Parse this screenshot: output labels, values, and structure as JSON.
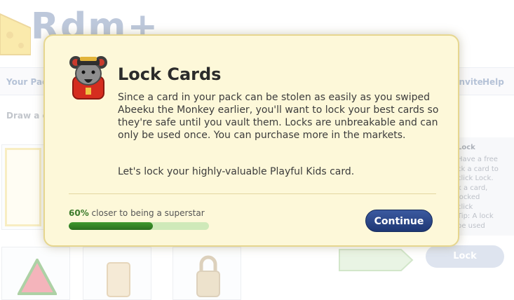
{
  "background": {
    "logo_text": "Rdm+",
    "nav": {
      "left_label": "Your Pack",
      "invite_label": "Invite",
      "help_label": "Help"
    },
    "subnav_label": "Draw a card",
    "side_panel": {
      "title": "Lock",
      "lines": [
        "Have a free",
        "ck a card to",
        "click Lock.",
        "k a card,",
        "locked",
        "click",
        "Tip: A lock",
        "be used"
      ]
    },
    "lock_button_label": "Lock"
  },
  "modal": {
    "title": "Lock Cards",
    "body": "Since a card in your pack can be stolen as easily as you swiped Abeeku the Monkey earlier, you'll want to lock your best cards so they're safe until you vault them. Locks are unbreakable and can only be used once. You can purchase more in the markets.",
    "prompt": "Let's lock your highly-valuable Playful Kids card.",
    "progress": {
      "percent_label": "60%",
      "label_rest": " closer to being a superstar",
      "value": 0.6
    },
    "continue_label": "Continue"
  },
  "colors": {
    "modal_bg": "#fdf8d9",
    "button": "#2b4687",
    "progress_fill": "#2f7d22"
  },
  "icons": {
    "modal_icon": "lucky-cat-icon"
  }
}
